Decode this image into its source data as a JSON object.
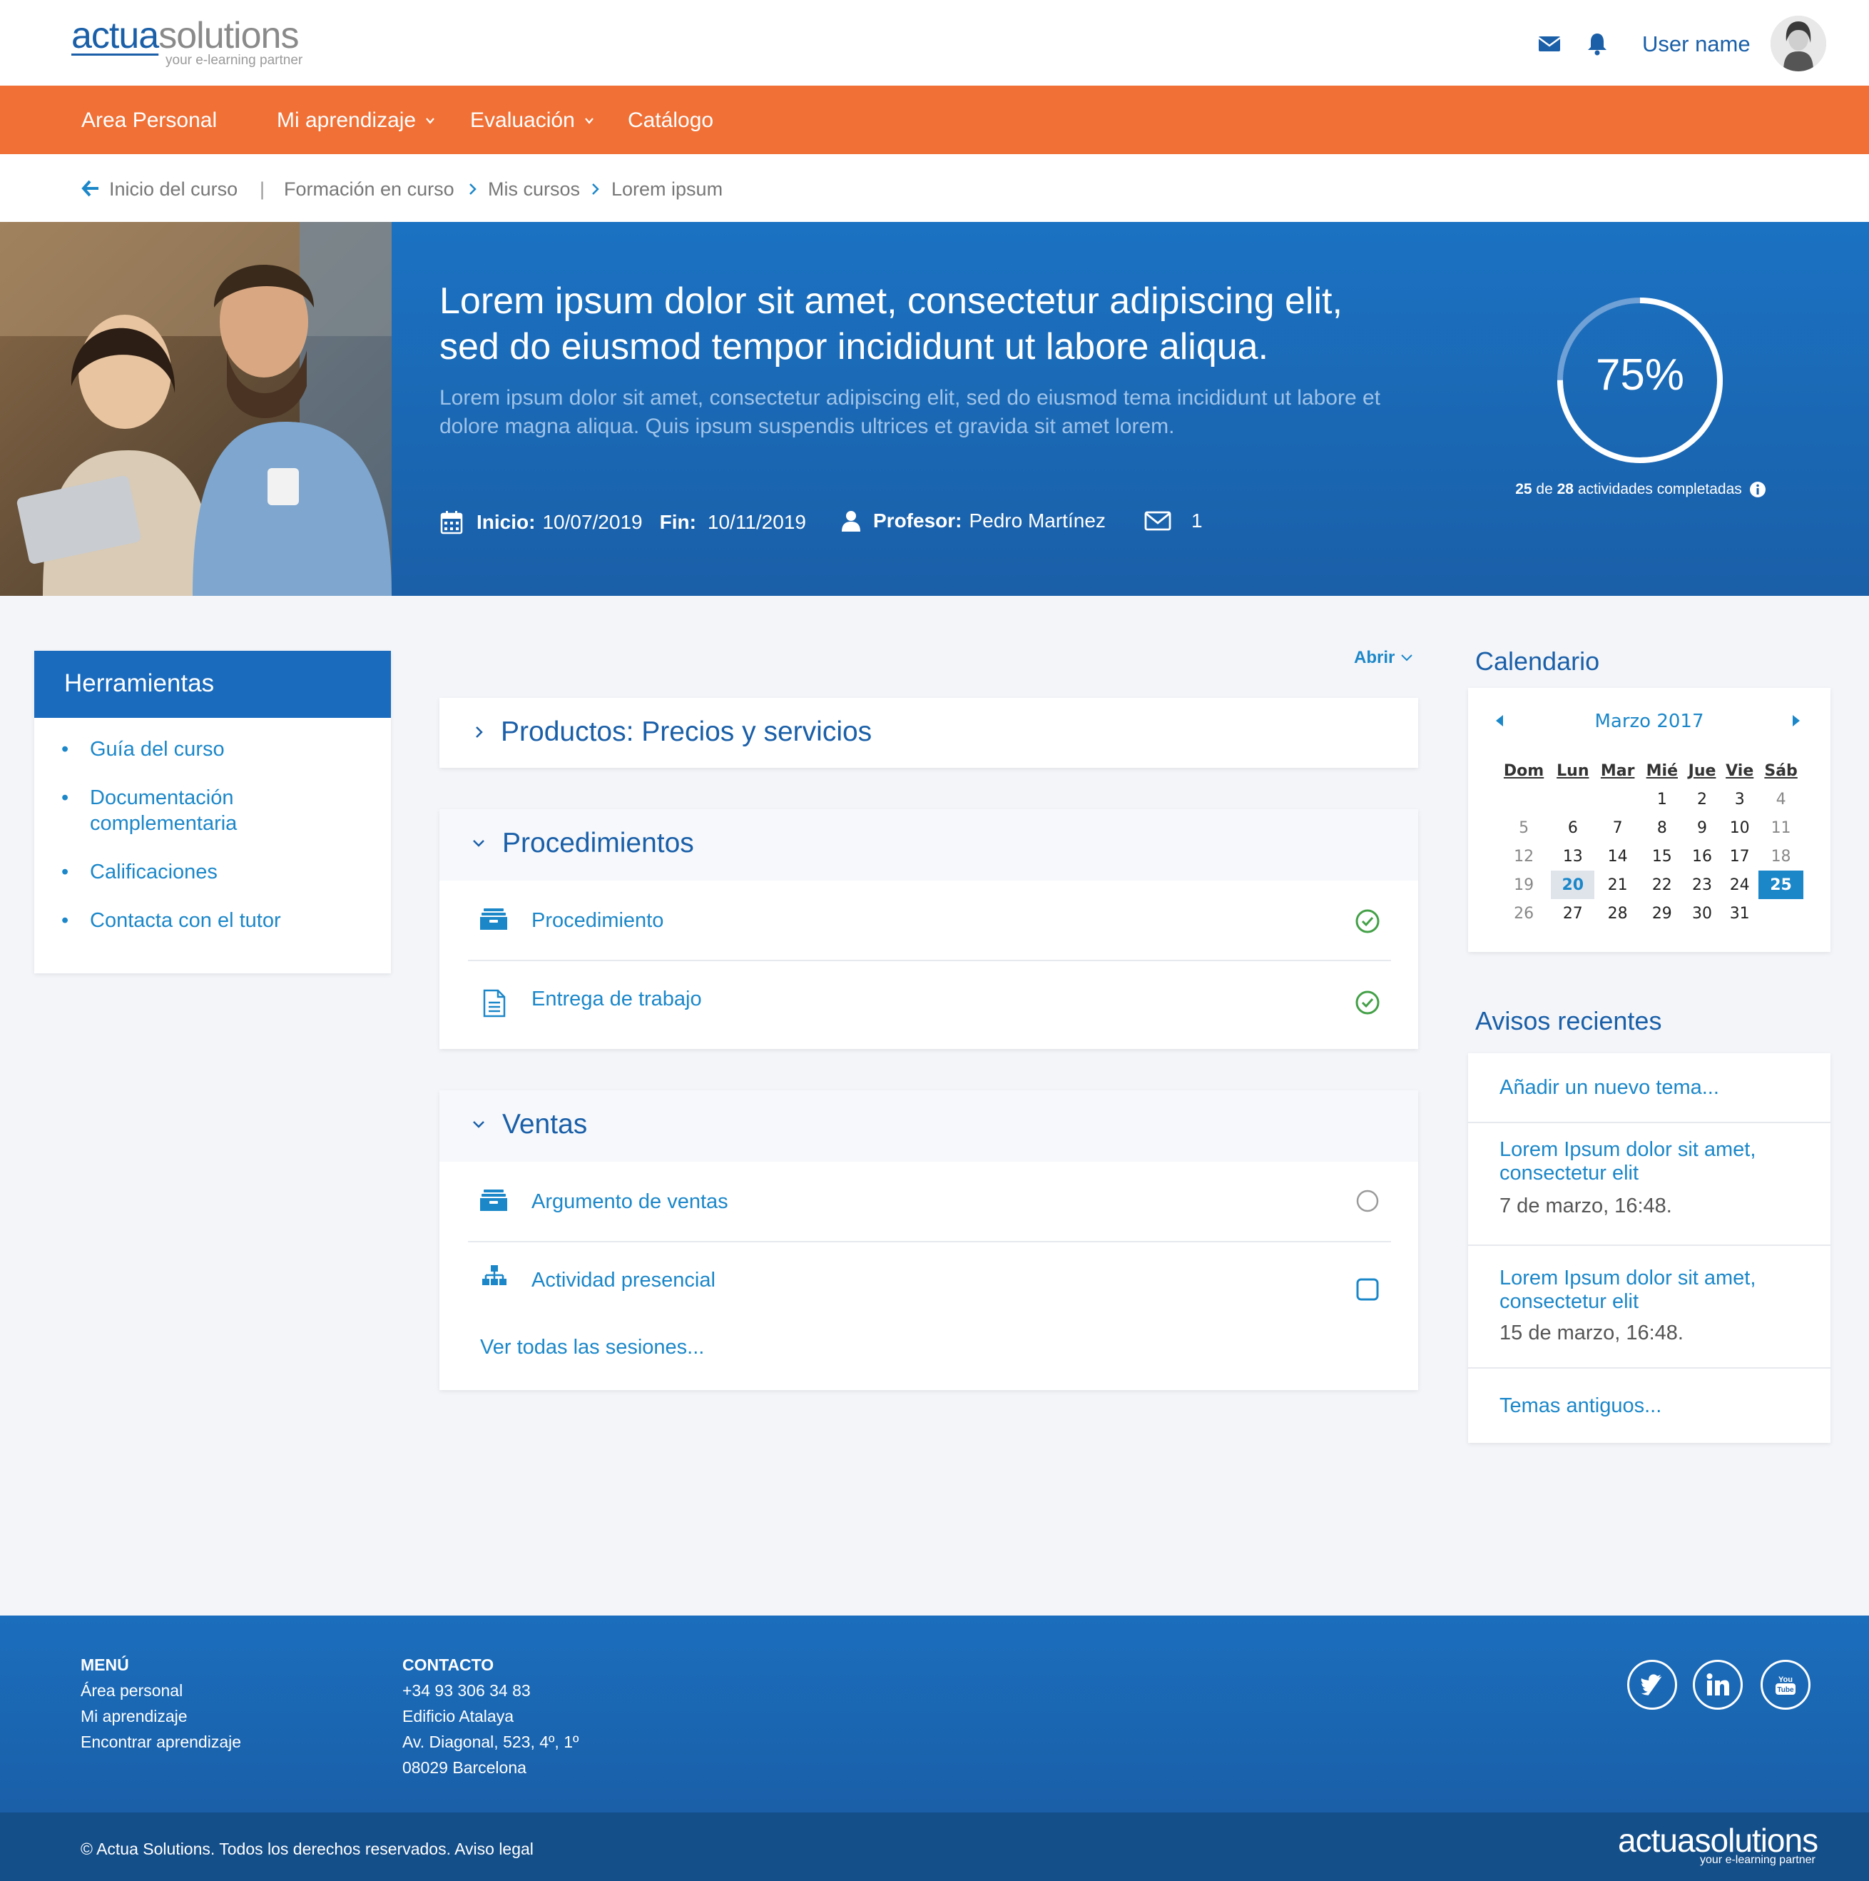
{
  "header": {
    "logo_part1": "actua",
    "logo_part2": "solutions",
    "logo_tagline": "your e-learning partner",
    "username": "User name"
  },
  "nav": {
    "items": [
      {
        "label": "Area Personal"
      },
      {
        "label": "Mi aprendizaje"
      },
      {
        "label": "Evaluación"
      },
      {
        "label": "Catálogo"
      }
    ]
  },
  "breadcrumb": {
    "back": "Inicio del curso",
    "separator": "|",
    "items": [
      "Formación en curso",
      "Mis cursos",
      "Lorem ipsum"
    ]
  },
  "hero": {
    "title": "Lorem ipsum dolor sit amet, consectetur adipiscing elit, sed do eiusmod tempor incididunt ut labore aliqua.",
    "subtitle": "Lorem ipsum dolor sit amet, consectetur adipiscing elit, sed do eiusmod tema incididunt ut labore et dolore magna aliqua. Quis ipsum suspendis ultrices et gravida sit amet lorem.",
    "start_label": "Inicio:",
    "start_value": "10/07/2019",
    "end_label": "Fin:",
    "end_value": "10/11/2019",
    "teacher_label": "Profesor:",
    "teacher_value": "Pedro Martínez",
    "messages": "1",
    "progress_percent": 75,
    "progress_text": "75%",
    "completed": "25",
    "completed_of": "de",
    "total": "28",
    "completed_suffix": "actividades completadas"
  },
  "tools": {
    "title": "Herramientas",
    "items": [
      "Guía del curso",
      "Documentación complementaria",
      "Calificaciones",
      "Contacta con el tutor"
    ]
  },
  "content": {
    "expand_label": "Abrir",
    "sections": [
      {
        "title": "Productos: Precios y servicios",
        "expanded": false
      },
      {
        "title": "Procedimientos",
        "expanded": true,
        "rows": [
          {
            "label": "Procedimiento",
            "icon": "inbox-icon",
            "status": "completed"
          },
          {
            "label": "Entrega de trabajo",
            "icon": "document-icon",
            "status": "completed"
          }
        ]
      },
      {
        "title": "Ventas",
        "expanded": true,
        "rows": [
          {
            "label": "Argumento de ventas",
            "icon": "inbox-icon",
            "status": "pending"
          },
          {
            "label": "Actividad presencial",
            "icon": "hierarchy-icon",
            "status": "unchecked"
          }
        ],
        "more": "Ver todas las sesiones..."
      }
    ]
  },
  "calendar": {
    "title": "Calendario",
    "month": "Marzo 2017",
    "days": [
      "Dom",
      "Lun",
      "Mar",
      "Mié",
      "Jue",
      "Vie",
      "Sáb"
    ],
    "weeks": [
      [
        "",
        "",
        "",
        "1",
        "2",
        "3",
        "4"
      ],
      [
        "5",
        "6",
        "7",
        "8",
        "9",
        "10",
        "11"
      ],
      [
        "12",
        "13",
        "14",
        "15",
        "16",
        "17",
        "18"
      ],
      [
        "19",
        "20",
        "21",
        "22",
        "23",
        "24",
        "25"
      ],
      [
        "26",
        "27",
        "28",
        "29",
        "30",
        "31",
        ""
      ]
    ],
    "today": "20",
    "selected": "25"
  },
  "notices": {
    "title": "Avisos recientes",
    "add": "Añadir un nuevo tema...",
    "items": [
      {
        "title": "Lorem Ipsum dolor sit amet, consectetur elit",
        "date": "7 de marzo, 16:48."
      },
      {
        "title": "Lorem Ipsum dolor sit amet, consectetur elit",
        "date": "15 de marzo, 16:48."
      }
    ],
    "older": "Temas antiguos..."
  },
  "footer": {
    "menu_title": "MENÚ",
    "menu_items": [
      "Área personal",
      "Mi aprendizaje",
      "Encontrar aprendizaje"
    ],
    "contact_title": "CONTACTO",
    "contact_lines": [
      "+34 93 306 34 83",
      "Edificio Atalaya",
      "Av. Diagonal, 523, 4º, 1º",
      "08029 Barcelona"
    ],
    "copyright": "© Actua Solutions. Todos los derechos reservados. Aviso legal",
    "logo": "actuasolutions",
    "logo_tagline": "your e-learning partner",
    "youtube_text_1": "You",
    "youtube_text_2": "Tube"
  },
  "colors": {
    "nav": "#f07036",
    "primary": "#1a5fa8",
    "link": "#1b87c9",
    "success": "#4caf50"
  }
}
